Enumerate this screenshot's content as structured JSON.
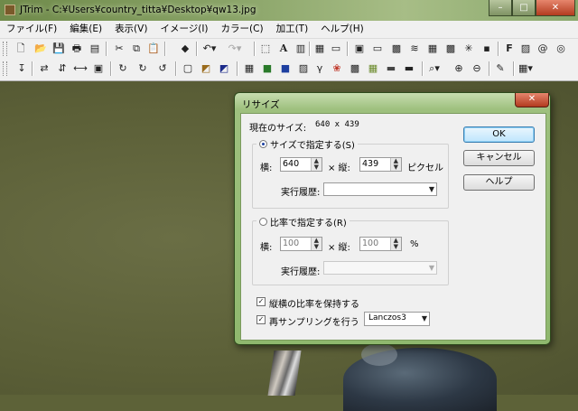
{
  "window": {
    "title": "JTrim - C:¥Users¥country_titta¥Desktop¥qw13.jpg",
    "min_label": "–",
    "max_label": "□",
    "close_label": "✕"
  },
  "menu": [
    "ファイル(F)",
    "編集(E)",
    "表示(V)",
    "イメージ(I)",
    "カラー(C)",
    "加工(T)",
    "ヘルプ(H)"
  ],
  "dialog": {
    "title": "リサイズ",
    "close_label": "✕",
    "current_size_label": "現在のサイズ:",
    "current_size_value": "640 x 439",
    "by_size": {
      "caption": "サイズで指定する(S)",
      "width_label": "横:",
      "width_value": "640",
      "times": "× 縦:",
      "height_value": "439",
      "unit": "ピクセル",
      "history_label": "実行履歴:",
      "history_value": ""
    },
    "by_ratio": {
      "caption": "比率で指定する(R)",
      "width_label": "横:",
      "width_value": "100",
      "times": "× 縦:",
      "height_value": "100",
      "unit": "%",
      "history_label": "実行履歴:",
      "history_value": ""
    },
    "keep_aspect_label": "縦横の比率を保持する",
    "resample_label": "再サンプリングを行う",
    "resample_method": "Lanczos3",
    "ok_label": "OK",
    "cancel_label": "キャンセル",
    "help_label": "ヘルプ"
  },
  "toolbar_icons_row1": [
    "new-file-icon",
    "open-file-icon",
    "save-icon",
    "print-icon",
    "print-preview-icon",
    "cut-icon",
    "copy-icon",
    "paste-icon",
    "paint-bucket-icon",
    "undo-icon",
    "redo-icon",
    "crop-icon",
    "text-icon",
    "resize-icon",
    "grid-icon",
    "film-icon",
    "bevel-icon",
    "frame-icon",
    "mosaic-icon",
    "wave-icon",
    "pixel-icon",
    "emboss-icon",
    "star-icon",
    "fx-icon",
    "swirl-icon",
    "redeye-icon"
  ],
  "toolbar_icons_row2": [
    "rotate-left-icon",
    "rotate-right-icon",
    "flip-h-icon",
    "flip-v-icon",
    "crop-center-icon",
    "rotate-90-icon",
    "rotate-180-icon",
    "rotate-270-icon",
    "gray-icon",
    "sepia-icon",
    "negative-icon",
    "palette-icon",
    "gradient-icon",
    "picture-icon",
    "gamma-icon",
    "rgb-icon",
    "noise-icon",
    "blur-icon",
    "contrast-icon",
    "zoom-icon",
    "zoom-in-icon",
    "zoom-out-icon",
    "eyedropper-icon",
    "tile-icon"
  ]
}
